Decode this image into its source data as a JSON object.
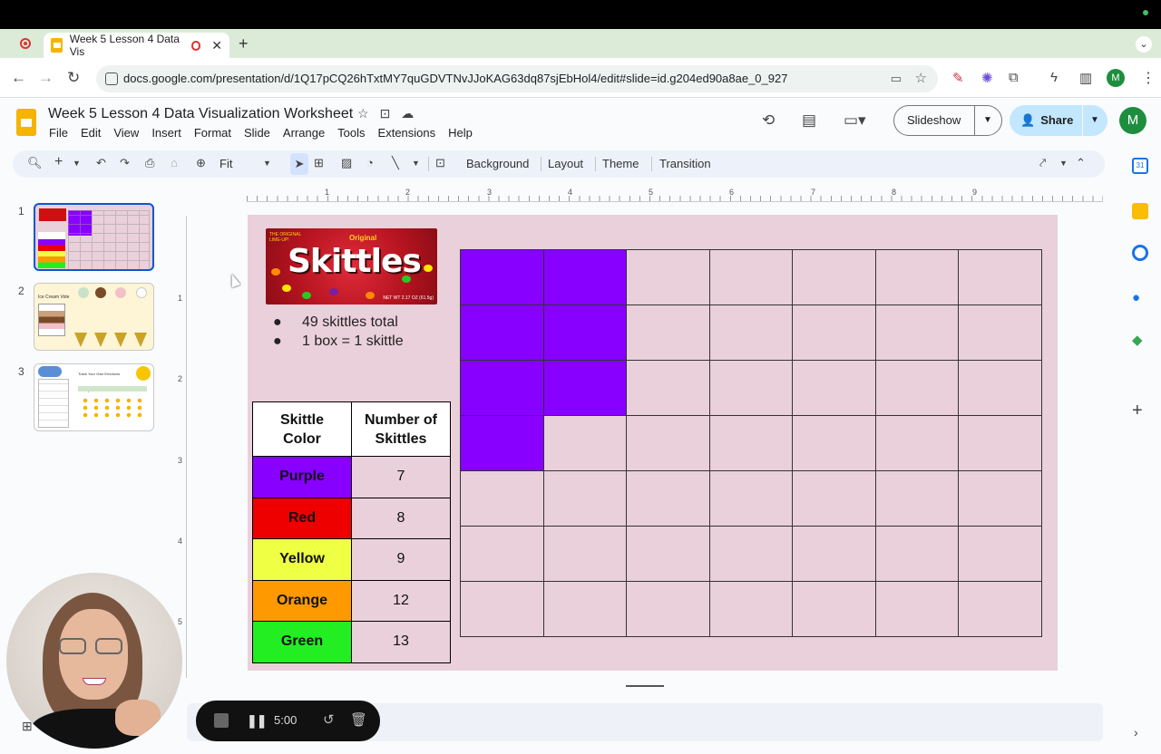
{
  "browser": {
    "tab_title": "Week 5 Lesson 4 Data Vis",
    "url": "docs.google.com/presentation/d/1Q17pCQ26hTxtMY7quGDVTNvJJoKAG63dq87sjEbHol4/edit#slide=id.g204ed90a8ae_0_927",
    "profile_initial": "M"
  },
  "app": {
    "doc_title": "Week 5 Lesson 4 Data Visualization Worksheet",
    "menu": [
      "File",
      "Edit",
      "View",
      "Insert",
      "Format",
      "Slide",
      "Arrange",
      "Tools",
      "Extensions",
      "Help"
    ],
    "slideshow_label": "Slideshow",
    "share_label": "Share",
    "avatar_initial": "M"
  },
  "toolbar": {
    "zoom_label": "Fit",
    "background_label": "Background",
    "layout_label": "Layout",
    "theme_label": "Theme",
    "transition_label": "Transition"
  },
  "filmstrip": {
    "slides": [
      {
        "number": "1",
        "selected": true
      },
      {
        "number": "2",
        "selected": false,
        "mini_title": "Ice Cream Vote"
      },
      {
        "number": "3",
        "selected": false,
        "mini_title": "Track Your Own Emotions",
        "mini_subtitle": "Daily Emotions Tracker"
      }
    ]
  },
  "ruler": {
    "h_labels": [
      "1",
      "2",
      "3",
      "4",
      "5",
      "6",
      "7",
      "8",
      "9"
    ],
    "v_labels": [
      "1",
      "2",
      "3",
      "4",
      "5"
    ]
  },
  "slide": {
    "product_image": {
      "brand": "Skittles",
      "tag": "Original",
      "corner_text": "THE ORIGINAL LIME-UP!",
      "net_wt": "NET WT 2.17 OZ (61.5g)"
    },
    "bullets": [
      "49 skittles total",
      "1 box = 1 skittle"
    ],
    "table": {
      "headers": [
        "Skittle Color",
        "Number of Skittles"
      ],
      "rows": [
        {
          "color": "Purple",
          "count": "7",
          "bg": "#8800ff"
        },
        {
          "color": "Red",
          "count": "8",
          "bg": "#ee0000"
        },
        {
          "color": "Yellow",
          "count": "9",
          "bg": "#eeff44"
        },
        {
          "color": "Orange",
          "count": "12",
          "bg": "#ff9900"
        },
        {
          "color": "Green",
          "count": "13",
          "bg": "#22ee22"
        }
      ]
    },
    "grid": {
      "columns": 7,
      "rows": 7,
      "fill_color": "#8800ff",
      "filled_cells": [
        [
          0,
          0
        ],
        [
          0,
          1
        ],
        [
          1,
          0
        ],
        [
          1,
          1
        ],
        [
          2,
          0
        ],
        [
          2,
          1
        ],
        [
          3,
          0
        ]
      ]
    }
  },
  "recorder": {
    "time": "5:00"
  },
  "colors": {
    "slide_bg": "#ead0da",
    "accent": "#0b57d0",
    "share_bg": "#c2e7ff"
  }
}
